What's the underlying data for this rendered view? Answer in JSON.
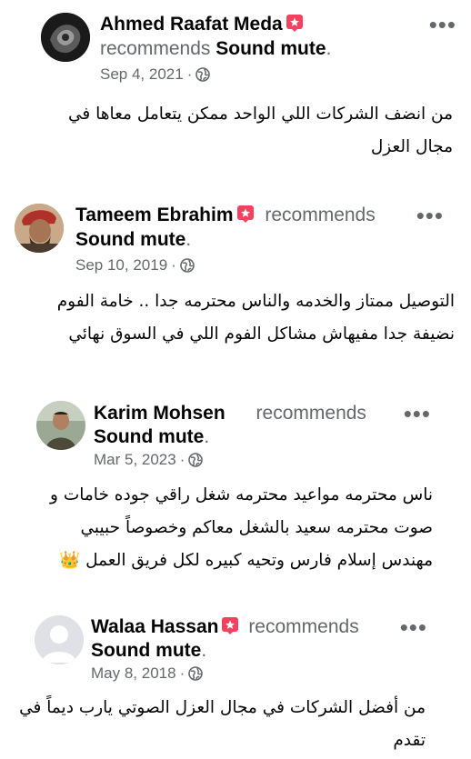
{
  "reviews": [
    {
      "name": "Ahmed Raafat Meda",
      "action": "recommends",
      "page": "Sound mute",
      "date": "Sep 4, 2021",
      "text_line1": "من انضف الشركات اللي الواحد ممكن يتعامل معاها في",
      "text_line2": "مجال العزل"
    },
    {
      "name": "Tameem Ebrahim",
      "action": "recommends",
      "page": "Sound mute",
      "date": "Sep 10, 2019",
      "text_line1": "التوصيل ممتاز والخدمه والناس محترمه جدا .. خامة الفوم",
      "text_line2": "نضيفة جدا مفيهاش مشاكل الفوم اللي في السوق نهائي"
    },
    {
      "name": "Karim Mohsen",
      "action": "recommends",
      "page": "Sound mute",
      "date": "Mar 5, 2023",
      "text_line1": "ناس محترمه مواعيد محترمه شغل راقي جوده خامات و",
      "text_line2": "صوت محترمه سعيد بالشغل معاكم وخصوصاً حبيبي",
      "text_line3": "مهندس إسلام فارس وتحيه كبيره لكل فريق العمل 👑"
    },
    {
      "name": "Walaa Hassan",
      "action": "recommends",
      "page": "Sound mute",
      "date": "May 8, 2018",
      "text_line1": "من أفضل الشركات في مجال العزل الصوتي يارب ديماً في",
      "text_line2": "تقدم"
    }
  ],
  "separator": "·",
  "period": ".",
  "more_label": "•••",
  "icons": {
    "recommend": "recommend-badge-icon",
    "privacy": "globe-icon",
    "more": "more-options-icon"
  },
  "colors": {
    "badge": "#f3425f",
    "secondary_text": "#65676b",
    "primary_text": "#050505"
  }
}
